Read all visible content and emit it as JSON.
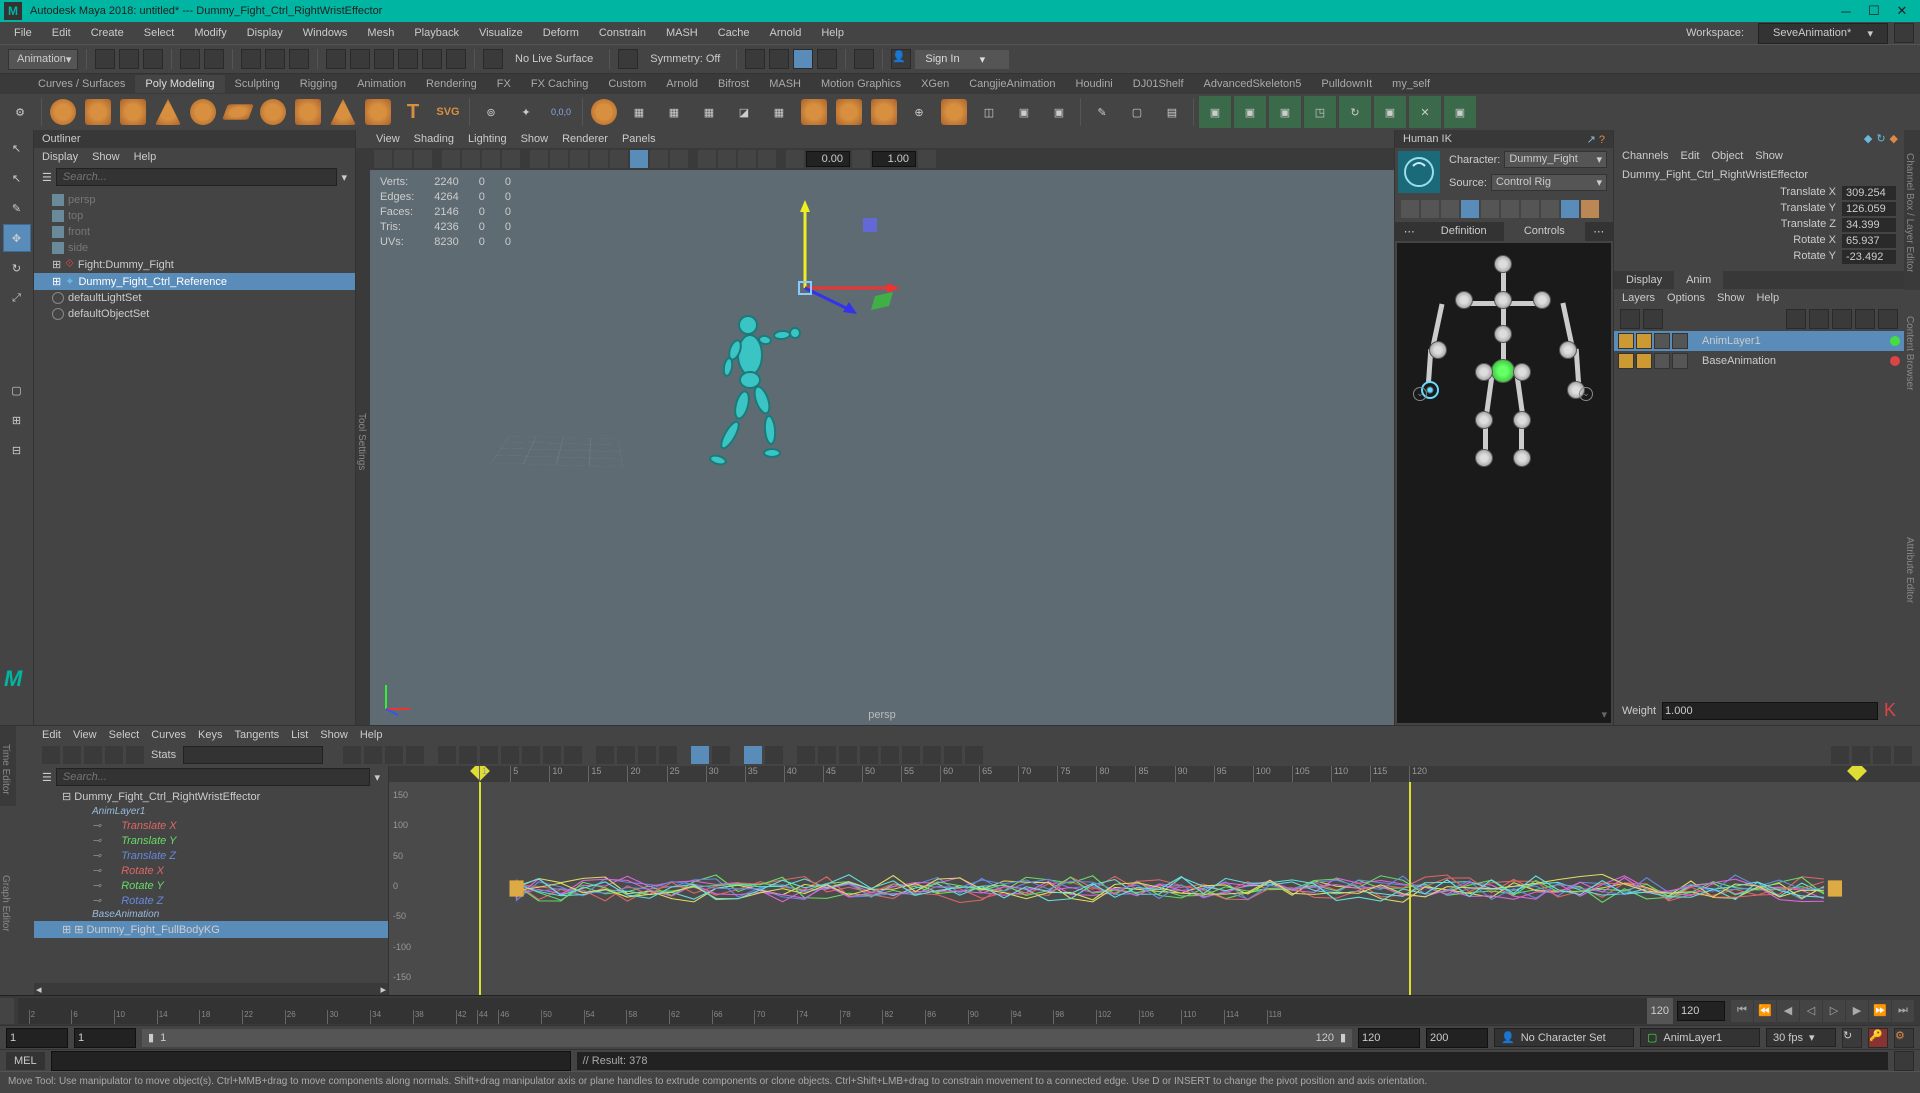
{
  "title": "Autodesk Maya 2018: untitled*   ---   Dummy_Fight_Ctrl_RightWristEffector",
  "workspace": {
    "label": "Workspace:",
    "value": "SeveAnimation*"
  },
  "mainmenu": [
    "File",
    "Edit",
    "Create",
    "Select",
    "Modify",
    "Display",
    "Windows",
    "Mesh",
    "Playback",
    "Visualize",
    "Deform",
    "Constrain",
    "MASH",
    "Cache",
    "Arnold",
    "Help"
  ],
  "moduleSelector": "Animation",
  "noLiveSurface": "No Live Surface",
  "symmetry": "Symmetry: Off",
  "signIn": "Sign In",
  "shelfTabs": [
    "Curves / Surfaces",
    "Poly Modeling",
    "Sculpting",
    "Rigging",
    "Animation",
    "Rendering",
    "FX",
    "FX Caching",
    "Custom",
    "Arnold",
    "Bifrost",
    "MASH",
    "Motion Graphics",
    "XGen",
    "CangjieAnimation",
    "Houdini",
    "DJ01Shelf",
    "AdvancedSkeleton5",
    "PulldownIt",
    "my_self"
  ],
  "shelfActive": 1,
  "outliner": {
    "title": "Outliner",
    "menu": [
      "Display",
      "Show",
      "Help"
    ],
    "search": "Search...",
    "items": [
      {
        "label": "persp",
        "dim": true
      },
      {
        "label": "top",
        "dim": true
      },
      {
        "label": "front",
        "dim": true
      },
      {
        "label": "side",
        "dim": true
      },
      {
        "label": "Fight:Dummy_Fight",
        "icon": "ref"
      },
      {
        "label": "Dummy_Fight_Ctrl_Reference",
        "icon": "ik",
        "sel": true
      },
      {
        "label": "defaultLightSet",
        "icon": "set"
      },
      {
        "label": "defaultObjectSet",
        "icon": "set"
      }
    ]
  },
  "viewport": {
    "menu": [
      "View",
      "Shading",
      "Lighting",
      "Show",
      "Renderer",
      "Panels"
    ],
    "toolSettingsTab": "Tool Settings",
    "hud": {
      "rows": [
        [
          "Verts:",
          "2240",
          "0",
          "0"
        ],
        [
          "Edges:",
          "4264",
          "0",
          "0"
        ],
        [
          "Faces:",
          "2146",
          "0",
          "0"
        ],
        [
          "Tris:",
          "4236",
          "0",
          "0"
        ],
        [
          "UVs:",
          "8230",
          "0",
          "0"
        ]
      ]
    },
    "camLabel": "persp",
    "field1": "0.00",
    "field2": "1.00"
  },
  "humanIK": {
    "title": "Human IK",
    "charLabel": "Character:",
    "character": "Dummy_Fight",
    "srcLabel": "Source:",
    "source": "Control Rig",
    "tabs": [
      "Definition",
      "Controls"
    ],
    "tabActive": 1
  },
  "channelBox": {
    "menu": [
      "Channels",
      "Edit",
      "Object",
      "Show"
    ],
    "node": "Dummy_Fight_Ctrl_RightWristEffector",
    "attrs": [
      {
        "l": "Translate X",
        "v": "309.254"
      },
      {
        "l": "Translate Y",
        "v": "126.059"
      },
      {
        "l": "Translate Z",
        "v": "34.399"
      },
      {
        "l": "Rotate X",
        "v": "65.937"
      },
      {
        "l": "Rotate Y",
        "v": "-23.492"
      }
    ],
    "sideTab": "Channel Box / Layer Editor",
    "sideTab2": "Attribute Editor"
  },
  "layers": {
    "tabs": [
      "Display",
      "Anim"
    ],
    "active": 1,
    "menu": [
      "Layers",
      "Options",
      "Show",
      "Help"
    ],
    "items": [
      {
        "name": "AnimLayer1",
        "sel": true
      },
      {
        "name": "BaseAnimation"
      }
    ],
    "weightLabel": "Weight",
    "weight": "1.000"
  },
  "graphEditor": {
    "sideTab": "Time Editor",
    "sideTab2": "Graph Editor",
    "menu": [
      "Edit",
      "View",
      "Select",
      "Curves",
      "Keys",
      "Tangents",
      "List",
      "Show",
      "Help"
    ],
    "stats": "Stats",
    "search": "Search...",
    "tree": {
      "root": "Dummy_Fight_Ctrl_RightWristEffector",
      "layer1": "AnimLayer1",
      "channels": [
        {
          "l": "Translate X",
          "c": "#d66"
        },
        {
          "l": "Translate Y",
          "c": "#6d6"
        },
        {
          "l": "Translate Z",
          "c": "#68d"
        },
        {
          "l": "Rotate X",
          "c": "#d66"
        },
        {
          "l": "Rotate Y",
          "c": "#6d6"
        },
        {
          "l": "Rotate Z",
          "c": "#68d"
        }
      ],
      "base": "BaseAnimation",
      "fullbody": "Dummy_Fight_FullBodyKG"
    },
    "xticks": [
      1,
      5,
      10,
      15,
      20,
      25,
      30,
      35,
      40,
      45,
      50,
      55,
      60,
      65,
      70,
      75,
      80,
      85,
      90,
      95,
      100,
      105,
      110,
      115,
      120
    ],
    "yticks": [
      150,
      100,
      50,
      0,
      -50,
      -100,
      -150
    ],
    "cursor": 120,
    "keymarker": 1
  },
  "timeSlider": {
    "ticks": [
      2,
      6,
      10,
      14,
      18,
      22,
      26,
      30,
      34,
      38,
      42,
      44,
      46,
      50,
      54,
      58,
      62,
      66,
      70,
      74,
      78,
      82,
      86,
      90,
      94,
      98,
      102,
      106,
      110,
      114,
      118
    ],
    "current": 120,
    "curLabel": "120"
  },
  "range": {
    "start": "1",
    "rangeStart": "1",
    "rangeEnd": "120",
    "end": "120",
    "end2": "200",
    "noCharSet": "No Character Set",
    "animLayer": "AnimLayer1",
    "fps": "30 fps"
  },
  "cmd": {
    "lang": "MEL",
    "result": "// Result: 378"
  },
  "help": "Move Tool: Use manipulator to move object(s). Ctrl+MMB+drag to move components along normals. Shift+drag manipulator axis or plane handles to extrude components or clone objects. Ctrl+Shift+LMB+drag to constrain movement to a connected edge. Use D or INSERT to change the pivot position and axis orientation."
}
